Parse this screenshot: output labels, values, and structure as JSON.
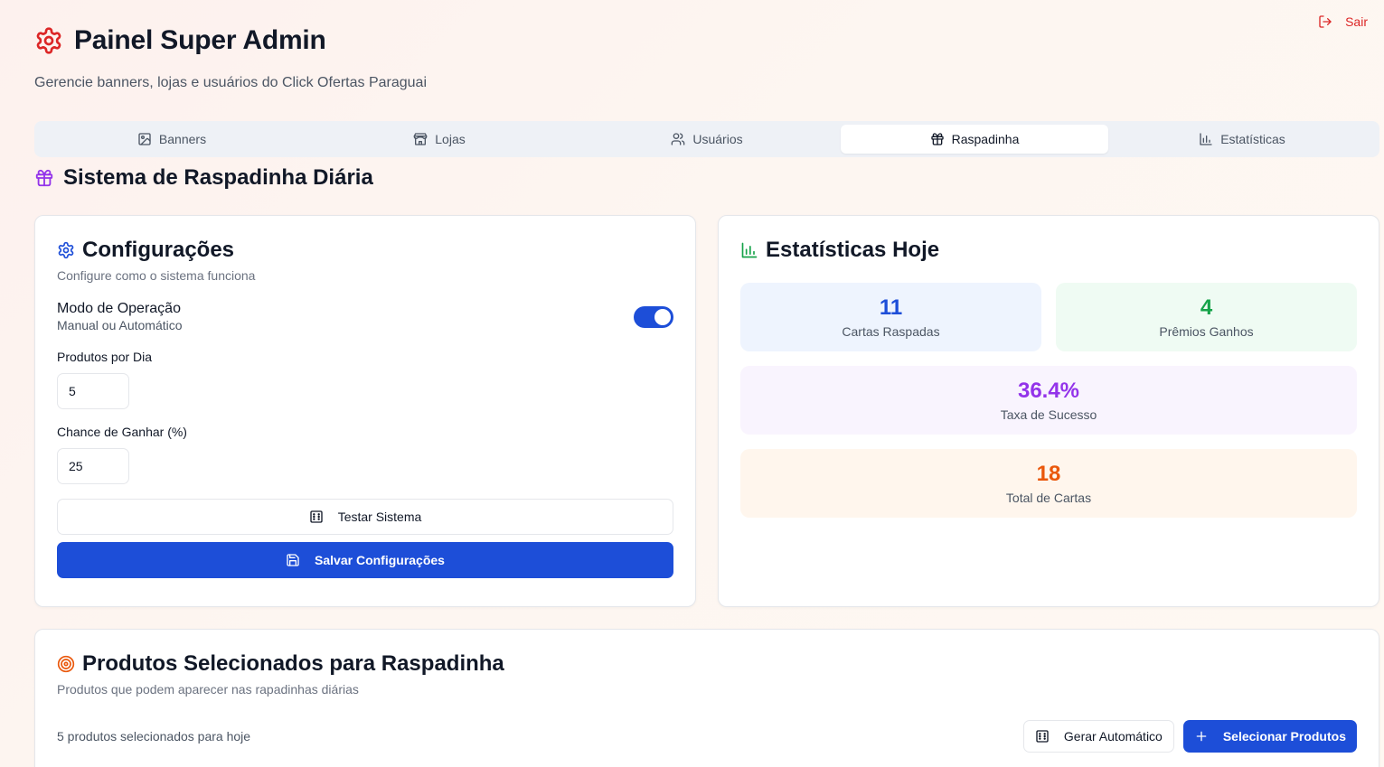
{
  "header": {
    "title": "Painel Super Admin",
    "subtitle": "Gerencie banners, lojas e usuários do Click Ofertas Paraguai",
    "logout_label": "Sair"
  },
  "tabs": [
    {
      "label": "Banners",
      "icon": "image-icon",
      "active": false
    },
    {
      "label": "Lojas",
      "icon": "store-icon",
      "active": false
    },
    {
      "label": "Usuários",
      "icon": "users-icon",
      "active": false
    },
    {
      "label": "Raspadinha",
      "icon": "gift-icon",
      "active": true
    },
    {
      "label": "Estatísticas",
      "icon": "bar-chart-icon",
      "active": false
    }
  ],
  "section": {
    "title": "Sistema de Raspadinha Diária"
  },
  "config": {
    "title": "Configurações",
    "description": "Configure como o sistema funciona",
    "mode_label": "Modo de Operação",
    "mode_sub": "Manual ou Automático",
    "mode_enabled": true,
    "products_per_day_label": "Produtos por Dia",
    "products_per_day_value": "5",
    "win_chance_label": "Chance de Ganhar (%)",
    "win_chance_value": "25",
    "test_button": "Testar Sistema",
    "save_button": "Salvar Configurações"
  },
  "stats": {
    "title": "Estatísticas Hoje",
    "cards": [
      {
        "value": "11",
        "label": "Cartas Raspadas",
        "color": "#1d4ed8",
        "bg": "#eef4fe"
      },
      {
        "value": "4",
        "label": "Prêmios Ganhos",
        "color": "#16a34a",
        "bg": "#effbf3"
      },
      {
        "value": "36.4%",
        "label": "Taxa de Sucesso",
        "color": "#9333ea",
        "bg": "#f9f4fe"
      },
      {
        "value": "18",
        "label": "Total de Cartas",
        "color": "#ea580c",
        "bg": "#fff6ed"
      }
    ]
  },
  "products": {
    "title": "Produtos Selecionados para Raspadinha",
    "description": "Produtos que podem aparecer nas rapadinhas diárias",
    "count_text": "5 produtos selecionados para hoje",
    "auto_button": "Gerar Automático",
    "select_button": "Selecionar Produtos"
  },
  "colors": {
    "primary": "#1d4ed8",
    "danger": "#dc2626",
    "gift_accent": "#9333ea",
    "stats_icon": "#16a34a",
    "target_icon": "#ea580c"
  }
}
